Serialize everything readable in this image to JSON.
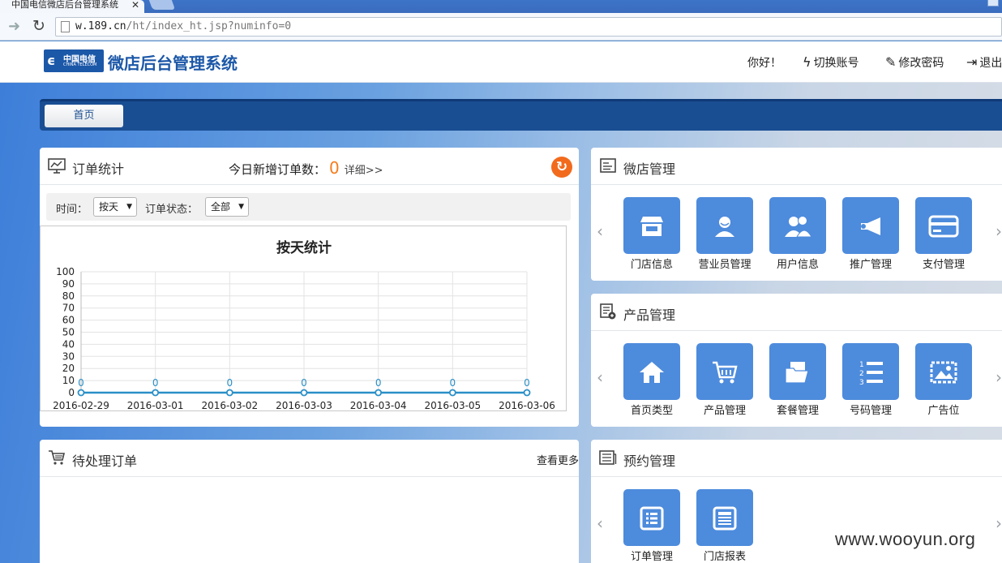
{
  "browser": {
    "tab_title": "中国电信微店后台管理系统",
    "url_host": "w.189.cn",
    "url_path": "/ht/index_ht.jsp?numinfo=0"
  },
  "header": {
    "logo_cn": "中国电信",
    "logo_en": "CHINA TELECOM",
    "title": "微店后台管理系统",
    "greeting": "你好！",
    "switch_account": "切换账号",
    "change_password": "修改密码",
    "logout": "退出"
  },
  "crumb": {
    "home": "首页"
  },
  "orders": {
    "title": "订单统计",
    "today_label": "今日新增订单数：",
    "today_count": "0",
    "details": "详细>>",
    "time_label": "时间：",
    "time_value": "按天",
    "status_label": "订单状态：",
    "status_value": "全部"
  },
  "chart_data": {
    "type": "line",
    "title": "按天统计",
    "x": [
      "2016-02-29",
      "2016-03-01",
      "2016-03-02",
      "2016-03-03",
      "2016-03-04",
      "2016-03-05",
      "2016-03-06"
    ],
    "series": [
      {
        "values": [
          0,
          0,
          0,
          0,
          0,
          0,
          0
        ]
      }
    ],
    "ylim": [
      0,
      100
    ],
    "yticks": [
      0,
      10,
      20,
      30,
      40,
      50,
      60,
      70,
      80,
      90,
      100
    ],
    "grid": true,
    "data_labels": true,
    "color": "#2a8fc7"
  },
  "pending": {
    "title": "待处理订单",
    "see_more": "查看更多"
  },
  "shop": {
    "title": "微店管理",
    "tiles": [
      {
        "label": "门店信息",
        "icon": "store-icon"
      },
      {
        "label": "营业员管理",
        "icon": "clerk-icon"
      },
      {
        "label": "用户信息",
        "icon": "users-icon"
      },
      {
        "label": "推广管理",
        "icon": "megaphone-icon"
      },
      {
        "label": "支付管理",
        "icon": "card-icon"
      }
    ]
  },
  "product": {
    "title": "产品管理",
    "tiles": [
      {
        "label": "首页类型",
        "icon": "home-icon"
      },
      {
        "label": "产品管理",
        "icon": "cart-icon"
      },
      {
        "label": "套餐管理",
        "icon": "folder-icon"
      },
      {
        "label": "号码管理",
        "icon": "numbered-list-icon"
      },
      {
        "label": "广告位",
        "icon": "picture-icon"
      }
    ]
  },
  "booking": {
    "title": "预约管理",
    "tiles": [
      {
        "label": "订单管理",
        "icon": "order-list-icon"
      },
      {
        "label": "门店报表",
        "icon": "report-icon"
      }
    ]
  },
  "watermark": "www.wooyun.org",
  "colors": {
    "brand": "#1c58a8",
    "tile": "#4d8bdc",
    "accent": "#f57c1e"
  }
}
